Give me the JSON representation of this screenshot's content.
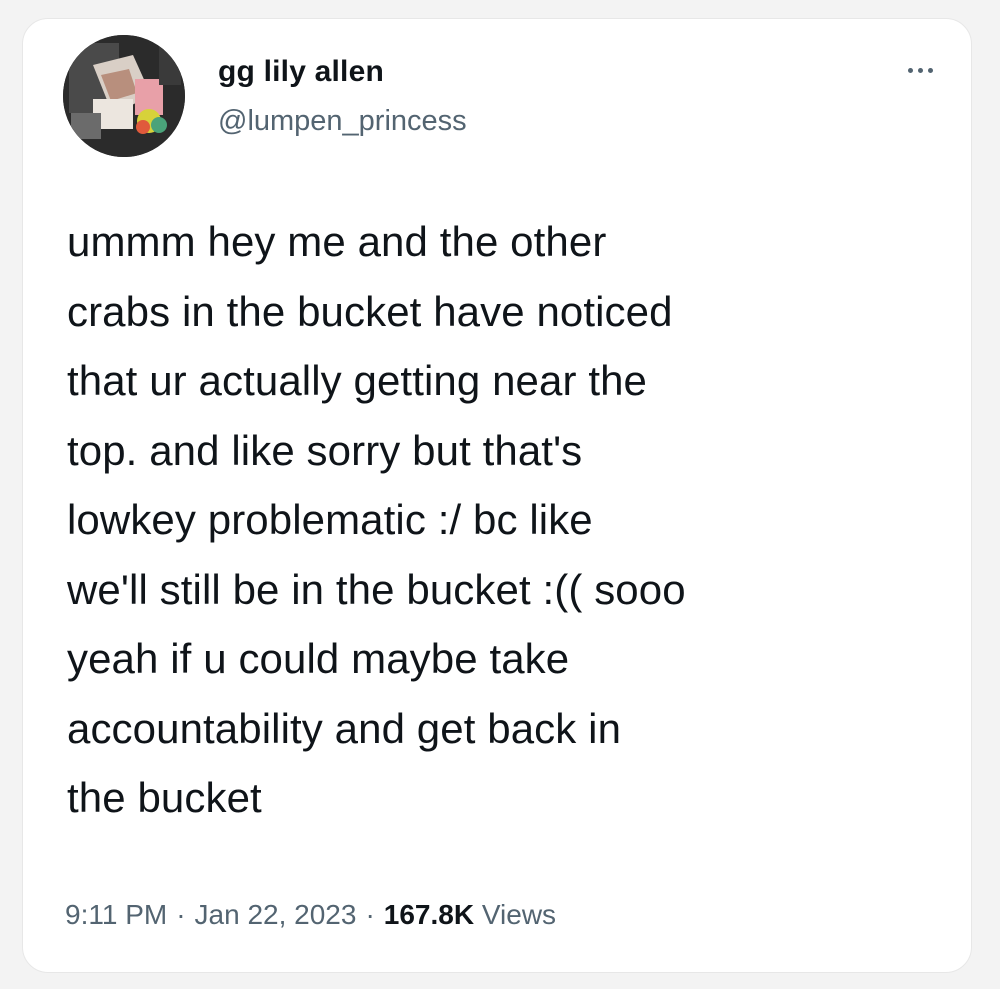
{
  "author": {
    "display_name": "gg lily allen",
    "handle": "@lumpen_princess"
  },
  "tweet": {
    "lines": [
      "ummm hey me and the other",
      "crabs in the bucket have noticed",
      "that ur actually getting near the",
      "top. and like sorry but that's",
      "lowkey problematic :/ bc like",
      "we'll still be in the bucket :(( sooo",
      "yeah if u could maybe take",
      "accountability and get back in",
      "the bucket"
    ]
  },
  "meta": {
    "time": "9:11 PM",
    "separator": "·",
    "date": "Jan 22, 2023",
    "views_count": "167.8K",
    "views_label": "Views"
  },
  "icons": {
    "more": "more-options-icon",
    "avatar": "profile-photo"
  },
  "colors": {
    "text_primary": "#0f1419",
    "text_secondary": "#536471",
    "card_background": "#ffffff"
  }
}
